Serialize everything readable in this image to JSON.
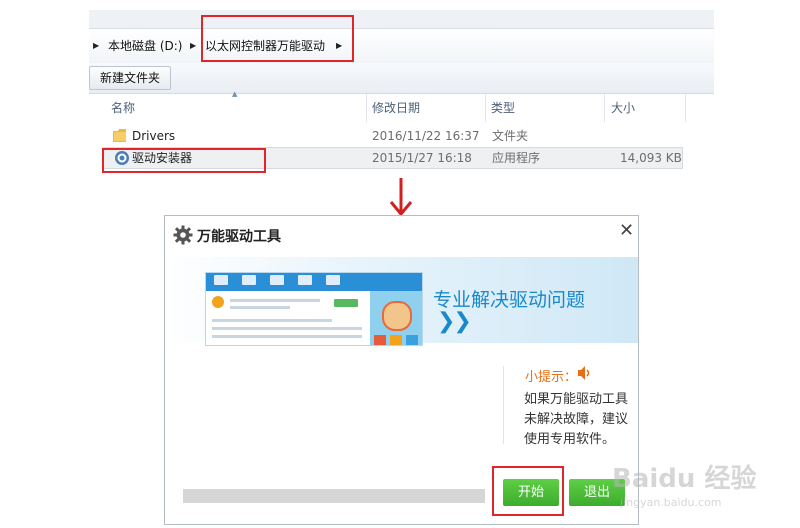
{
  "explorer": {
    "breadcrumb": [
      "本地磁盘 (D:)",
      "以太网控制器万能驱动"
    ],
    "toolbar": {
      "new_folder": "新建文件夹"
    },
    "columns": [
      "名称",
      "修改日期",
      "类型",
      "大小"
    ],
    "files": [
      {
        "name": "Drivers",
        "date": "2016/11/22 16:37",
        "type": "文件夹",
        "size": "",
        "icon": "folder-icon"
      },
      {
        "name": "驱动安装器",
        "date": "2015/1/27 16:18",
        "type": "应用程序",
        "size": "14,093 KB",
        "icon": "gear-icon"
      }
    ]
  },
  "dialog": {
    "title": "万能驱动工具",
    "banner": {
      "headline": "专业解决驱动问题",
      "chevrons": "❯❯"
    },
    "tip": {
      "label": "小提示：",
      "lines": [
        "如果万能驱动工具",
        "未解决故障，建议",
        "使用专用软件。"
      ]
    },
    "progress": 0,
    "buttons": {
      "start": "开始",
      "exit": "退出"
    },
    "close": "✕"
  },
  "colors": {
    "highlight": "#e0262b",
    "accent": "#1a89cc",
    "button_green": "#44b233",
    "tip_orange": "#e96e16"
  },
  "watermark": {
    "main": "Baidu 经验",
    "sub": "jingyan.baidu.com"
  }
}
